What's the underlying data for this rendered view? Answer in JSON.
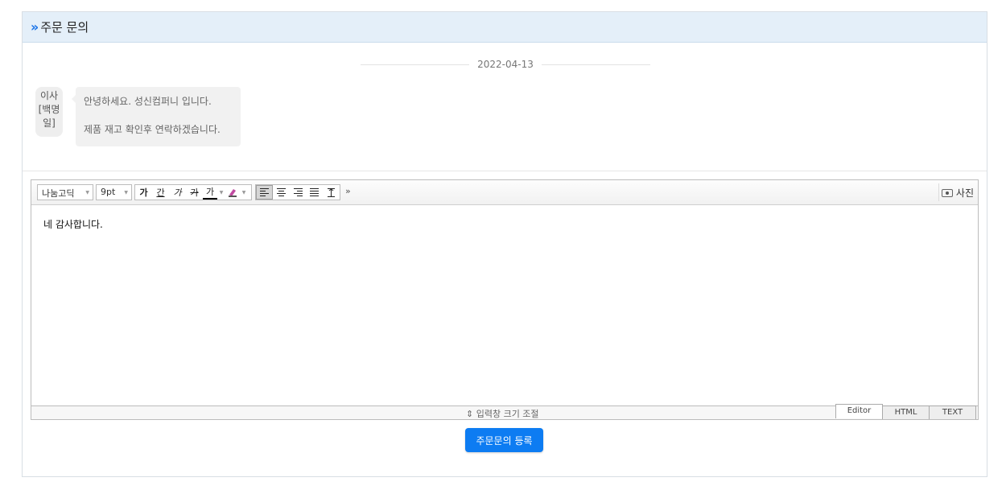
{
  "header": {
    "title": "주문 문의"
  },
  "chat": {
    "date": "2022-04-13",
    "sender_line1": "이사",
    "sender_line2": "[백명",
    "sender_line3": "일]",
    "message_line1": "안녕하세요. 성신컴퍼니 입니다.",
    "message_line2": "제품 재고 확인후 연락하겠습니다."
  },
  "toolbar": {
    "font_family": "나눔고딕",
    "font_size": "9pt",
    "bold": "가",
    "underline": "간",
    "italic": "가",
    "strike": "가",
    "font_color": "가",
    "more": "»",
    "photo_label": "사진"
  },
  "editor": {
    "content": "네 감사합니다.",
    "resize_label": "⇕ 입력창 크기 조절",
    "modes": [
      "Editor",
      "HTML",
      "TEXT"
    ]
  },
  "actions": {
    "submit_label": "주문문의 등록"
  },
  "colors": {
    "accent": "#0d7cf2",
    "header_bg": "#e4eff9"
  }
}
